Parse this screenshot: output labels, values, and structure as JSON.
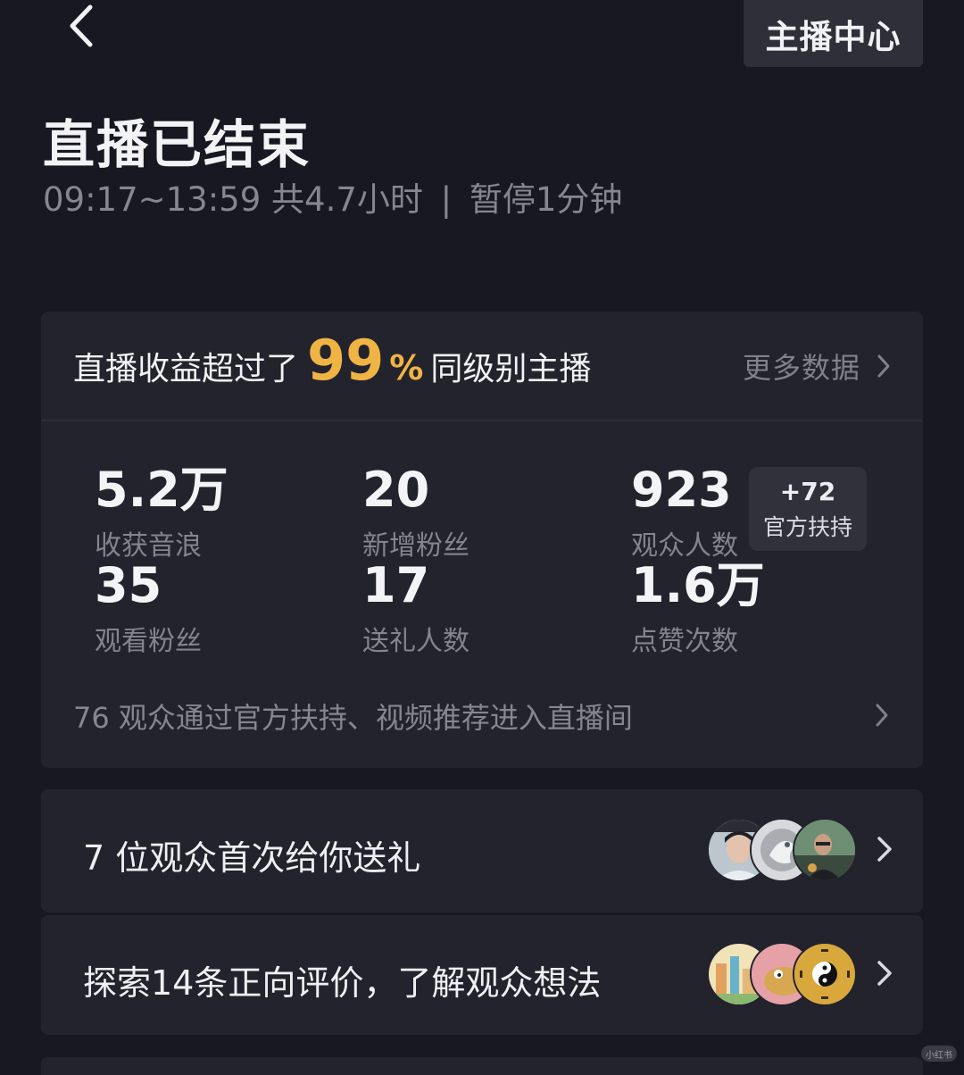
{
  "header": {
    "anchor_center_label": "主播中心"
  },
  "summary": {
    "title": "直播已结束",
    "time_range": "09:17~13:59",
    "duration": "共4.7小时",
    "separator": "|",
    "pause": "暂停1分钟"
  },
  "stats_card": {
    "rank_prefix": "直播收益超过了",
    "rank_percent": "99",
    "rank_percent_sign": "%",
    "rank_suffix": "同级别主播",
    "more_data_label": "更多数据",
    "stats": [
      {
        "value": "5.2万",
        "label": "收获音浪"
      },
      {
        "value": "20",
        "label": "新增粉丝"
      },
      {
        "value": "923",
        "label": "观众人数"
      },
      {
        "value": "35",
        "label": "观看粉丝"
      },
      {
        "value": "17",
        "label": "送礼人数"
      },
      {
        "value": "1.6万",
        "label": "点赞次数"
      }
    ],
    "bonus_badge": {
      "value": "+72",
      "label": "官方扶持"
    },
    "traffic_text": "76 观众通过官方扶持、视频推荐进入直播间"
  },
  "gift_row": {
    "text": "7 位观众首次给你送礼",
    "avatars": [
      "avatar-young-man",
      "avatar-silver-dragon",
      "avatar-man-with-glasses"
    ]
  },
  "review_row": {
    "text": "探索14条正向评价，了解观众想法",
    "avatars": [
      "avatar-city-scene",
      "avatar-cartoon-creature",
      "avatar-bagua-symbol"
    ]
  },
  "watermark": {
    "text": "小红书"
  },
  "colors": {
    "background": "#171821",
    "card": "#22232c",
    "accent_gold": "#f0b445",
    "muted_text": "#85868f"
  }
}
